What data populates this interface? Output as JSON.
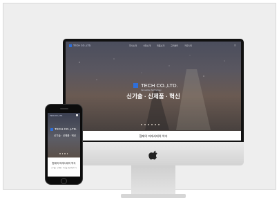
{
  "desktop": {
    "logo": "TECH CO.,LTD.",
    "nav_items": [
      "회사소개",
      "사업소개",
      "제품소개",
      "고객센터",
      "커뮤니티"
    ],
    "brand_name": "TECH CO.,LTD.",
    "brand_sub": "Innovative Technology",
    "hero_title": "신기술 · 신제품 · 혁신",
    "section_title": "협제의 미래서대의 약속"
  },
  "mobile": {
    "logo": "TECH CO.,LTD.",
    "brand_name": "TECH CO.,LTD.",
    "tagline": "신기술 · 신제품 · 혁신",
    "section_title": "협제의 미래서대의 약속",
    "section_sub": "신기술 · 신제품 · 혁신을 만들어갑니다"
  },
  "colors": {
    "accent": "#2f6fd9",
    "background": "#eeeeee"
  }
}
